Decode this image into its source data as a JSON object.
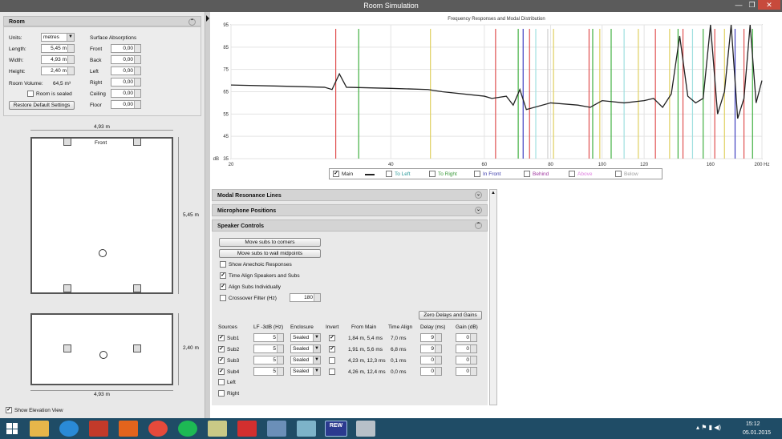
{
  "window": {
    "title": "Room Simulation"
  },
  "room": {
    "header": "Room",
    "units_label": "Units:",
    "units_value": "metres",
    "length_label": "Length:",
    "length_value": "5,45 m",
    "width_label": "Width:",
    "width_value": "4,93 m",
    "height_label": "Height:",
    "height_value": "2,40 m",
    "volume_label": "Room Volume:",
    "volume_value": "64,5 m³",
    "sealed_label": "Room is sealed",
    "restore_label": "Restore Default Settings",
    "absorption_title": "Surface Absorptions",
    "surfaces": [
      {
        "label": "Front",
        "value": "0,00"
      },
      {
        "label": "Back",
        "value": "0,00"
      },
      {
        "label": "Left",
        "value": "0,00"
      },
      {
        "label": "Right",
        "value": "0,00"
      },
      {
        "label": "Ceiling",
        "value": "0,00"
      },
      {
        "label": "Floor",
        "value": "0,00"
      }
    ]
  },
  "plan": {
    "top_width": "4,93 m",
    "front_label": "Front",
    "side_length": "5,45 m",
    "elev_height": "2,40 m",
    "elev_width": "4,93 m",
    "show_elevation_label": "Show Elevation View"
  },
  "chart_data": {
    "type": "line",
    "title": "Frequency Responses and Modal Distribution",
    "ylabel": "dB",
    "xlabel": "Hz",
    "x_ticks": [
      "20",
      "40",
      "60",
      "80",
      "100",
      "120",
      "160",
      "200 Hz"
    ],
    "y_ticks": [
      "95",
      "85",
      "75",
      "65",
      "55",
      "45",
      "35"
    ],
    "ylim": [
      35,
      95
    ],
    "series": [
      {
        "name": "Main",
        "x": [
          20,
          25,
          30,
          31,
          32,
          33,
          40,
          47,
          50,
          60,
          62,
          66,
          68,
          70,
          72,
          80,
          90,
          95,
          100,
          110,
          120,
          125,
          130,
          135,
          140,
          145,
          150,
          155,
          160,
          165,
          170,
          175,
          180,
          185,
          190,
          195,
          200
        ],
        "y": [
          68,
          67.5,
          67,
          66,
          73,
          67,
          66.5,
          66,
          65,
          63,
          62,
          63,
          59,
          66,
          57,
          60,
          59,
          58,
          61,
          60,
          61,
          62,
          58,
          64,
          90,
          63,
          60,
          62,
          95,
          55,
          65,
          95,
          53,
          62,
          95,
          60,
          70
        ]
      }
    ],
    "legend": [
      {
        "label": "Main",
        "checked": true,
        "color": "#222222"
      },
      {
        "label": "To Left",
        "checked": false,
        "color": "#2b9a9a"
      },
      {
        "label": "To Right",
        "checked": false,
        "color": "#3a9a3a"
      },
      {
        "label": "In Front",
        "checked": false,
        "color": "#3a3aaa"
      },
      {
        "label": "Behind",
        "checked": false,
        "color": "#a03aa0"
      },
      {
        "label": "Above",
        "checked": false,
        "color": "#e080e0"
      },
      {
        "label": "Below",
        "checked": false,
        "color": "#a0a0a0"
      }
    ],
    "modal_lines": [
      {
        "hz": 31.5,
        "color": "#e05050"
      },
      {
        "hz": 34.8,
        "color": "#40b040"
      },
      {
        "hz": 47.5,
        "color": "#e0d060"
      },
      {
        "hz": 63,
        "color": "#e05050"
      },
      {
        "hz": 69.5,
        "color": "#40b040"
      },
      {
        "hz": 71,
        "color": "#4040c0"
      },
      {
        "hz": 73,
        "color": "#e05050"
      },
      {
        "hz": 75,
        "color": "#a0e0e0"
      },
      {
        "hz": 79,
        "color": "#d0d0d0"
      },
      {
        "hz": 81,
        "color": "#e0d060"
      },
      {
        "hz": 94.5,
        "color": "#e05050"
      },
      {
        "hz": 96,
        "color": "#40b040"
      },
      {
        "hz": 99,
        "color": "#e0d060"
      },
      {
        "hz": 104,
        "color": "#40b040"
      },
      {
        "hz": 110,
        "color": "#a0e0e0"
      },
      {
        "hz": 117,
        "color": "#e0d060"
      },
      {
        "hz": 126,
        "color": "#e05050"
      },
      {
        "hz": 134,
        "color": "#e0d060"
      },
      {
        "hz": 139,
        "color": "#40b040"
      },
      {
        "hz": 142,
        "color": "#e05050"
      },
      {
        "hz": 148,
        "color": "#a0e0e0"
      },
      {
        "hz": 155,
        "color": "#40b040"
      },
      {
        "hz": 163,
        "color": "#e05050"
      },
      {
        "hz": 170,
        "color": "#e0d060"
      },
      {
        "hz": 178,
        "color": "#4040c0"
      },
      {
        "hz": 185,
        "color": "#e05050"
      },
      {
        "hz": 192,
        "color": "#40b040"
      }
    ]
  },
  "accordion": {
    "modal_header": "Modal Resonance Lines",
    "mic_header": "Microphone Positions",
    "speaker_header": "Speaker Controls",
    "move_corners": "Move subs to corners",
    "move_midpoints": "Move subs to wall midpoints",
    "anechoic_label": "Show Anechoic Responses",
    "time_align_label": "Time Align Speakers and Subs",
    "align_subs_label": "Align Subs Individually",
    "crossover_label": "Crossover Filter (Hz)",
    "crossover_value": "180",
    "zero_label": "Zero Delays and Gains",
    "columns": [
      "Sources",
      "LF -3dB (Hz)",
      "Enclosure",
      "Invert",
      "From Main",
      "Time Align",
      "Delay (ms)",
      "Gain (dB)"
    ],
    "subs": [
      {
        "name": "Sub1",
        "lf": "5",
        "enclosure": "Sealed",
        "invert": true,
        "from_main": "1,84 m, 5,4 ms",
        "time_align": "7,0 ms",
        "delay": "9",
        "gain": "0"
      },
      {
        "name": "Sub2",
        "lf": "5",
        "enclosure": "Sealed",
        "invert": true,
        "from_main": "1,91 m, 5,6 ms",
        "time_align": "6,8 ms",
        "delay": "9",
        "gain": "0"
      },
      {
        "name": "Sub3",
        "lf": "5",
        "enclosure": "Sealed",
        "invert": false,
        "from_main": "4,23 m, 12,3 ms",
        "time_align": "0,1 ms",
        "delay": "0",
        "gain": "0"
      },
      {
        "name": "Sub4",
        "lf": "5",
        "enclosure": "Sealed",
        "invert": false,
        "from_main": "4,26 m, 12,4 ms",
        "time_align": "0,0 ms",
        "delay": "0",
        "gain": "0"
      }
    ],
    "left_label": "Left",
    "right_label": "Right"
  },
  "taskbar": {
    "time": "15:12",
    "date": "05.01.2015",
    "rew_label": "REW"
  }
}
